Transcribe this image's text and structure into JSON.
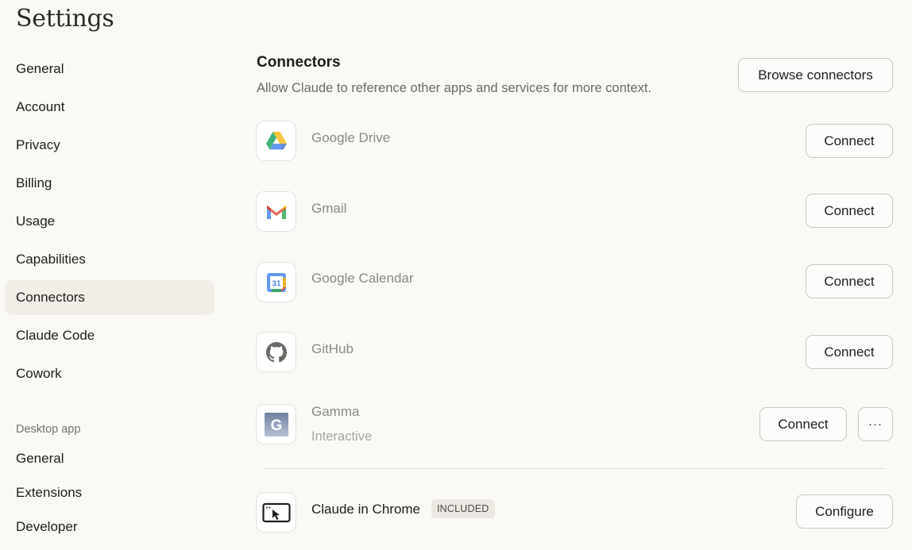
{
  "page": {
    "title": "Settings"
  },
  "sidebar": {
    "items": [
      {
        "label": "General"
      },
      {
        "label": "Account"
      },
      {
        "label": "Privacy"
      },
      {
        "label": "Billing"
      },
      {
        "label": "Usage"
      },
      {
        "label": "Capabilities"
      },
      {
        "label": "Connectors"
      },
      {
        "label": "Claude Code"
      },
      {
        "label": "Cowork"
      }
    ],
    "active_item": "Connectors",
    "desktop_section_label": "Desktop app",
    "desktop_items": [
      {
        "label": "General"
      },
      {
        "label": "Extensions"
      },
      {
        "label": "Developer"
      }
    ]
  },
  "main": {
    "title": "Connectors",
    "subtitle": "Allow Claude to reference other apps and services for more context.",
    "browse_label": "Browse connectors",
    "connectors": [
      {
        "name": "Google Drive",
        "icon": "google-drive-icon",
        "action": "Connect"
      },
      {
        "name": "Gmail",
        "icon": "gmail-icon",
        "action": "Connect"
      },
      {
        "name": "Google Calendar",
        "icon": "google-calendar-icon",
        "calendar_day": "31",
        "action": "Connect"
      },
      {
        "name": "GitHub",
        "icon": "github-icon",
        "action": "Connect"
      },
      {
        "name": "Gamma",
        "icon": "gamma-icon",
        "icon_letter": "G",
        "description": "Interactive",
        "action": "Connect",
        "more_label": "···"
      }
    ],
    "chrome": {
      "name": "Claude in Chrome",
      "icon": "chrome-extension-icon",
      "badge": "INCLUDED",
      "action": "Configure"
    }
  }
}
